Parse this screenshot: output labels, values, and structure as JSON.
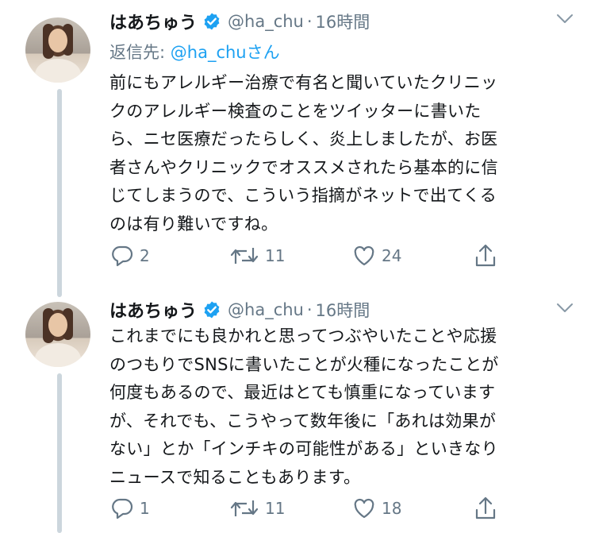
{
  "tweets": [
    {
      "name": "はあちゅう",
      "handle": "@ha_chu",
      "separator": "·",
      "time": "16時間",
      "reply_prefix": "返信先: ",
      "reply_mention": "@ha_chuさん",
      "lines": [
        "前にもアレルギー治療で有名と聞いていたクリニッ",
        "クのアレルギー検査のことをツイッターに書いた",
        "ら、ニセ医療だったらしく、炎上しましたが、お医",
        "者さんやクリニックでオススメされたら基本的に信",
        "じてしまうので、こういう指摘がネットで出てくる",
        "のは有り難いですね。"
      ],
      "replies": "2",
      "retweets": "11",
      "likes": "24"
    },
    {
      "name": "はあちゅう",
      "handle": "@ha_chu",
      "separator": "·",
      "time": "16時間",
      "lines": [
        "これまでにも良かれと思ってつぶやいたことや応援",
        "のつもりでSNSに書いたことが火種になったことが",
        "何度もあるので、最近はとても慎重になっています",
        "が、それでも、こうやって数年後に「あれは効果が",
        "ない」とか「インチキの可能性がある」といきなり",
        "ニュースで知ることもあります。"
      ],
      "replies": "1",
      "retweets": "11",
      "likes": "18"
    }
  ],
  "colors": {
    "text": "#14171a",
    "secondary": "#657786",
    "link": "#1da1f2",
    "verified": "#1da1f2",
    "thread_line": "#ccd6dd"
  },
  "icons": [
    "verified-badge-icon",
    "chevron-down-icon",
    "reply-icon",
    "retweet-icon",
    "like-icon",
    "share-icon"
  ]
}
